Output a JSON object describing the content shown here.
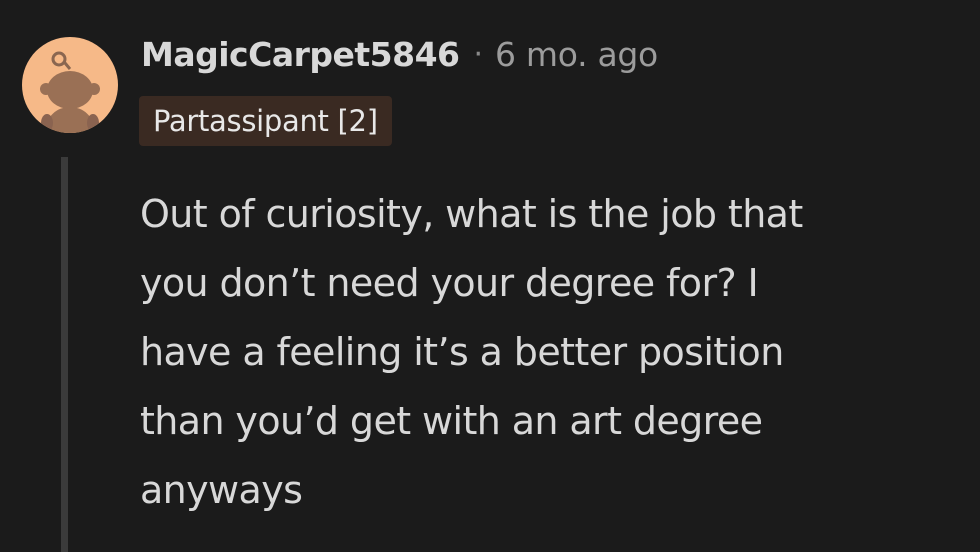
{
  "comment": {
    "username": "MagicCarpet5846",
    "separator": "·",
    "timestamp": "6 mo. ago",
    "flair": "Partassipant [2]",
    "body_lines": [
      "Out of curiosity, what is the job that",
      "you don’t need your degree for? I",
      "have a feeling it’s a better position",
      "than you’d get with an art degree",
      "anyways"
    ]
  },
  "colors": {
    "background": "#1b1b1b",
    "text": "#d8d8d8",
    "meta": "#9c9c9c",
    "avatar_bg": "#f6b988",
    "flair_bg": "#3a2a22",
    "thread_line": "#3b3b3b"
  },
  "icons": {
    "avatar": "snoo-avatar-icon"
  }
}
